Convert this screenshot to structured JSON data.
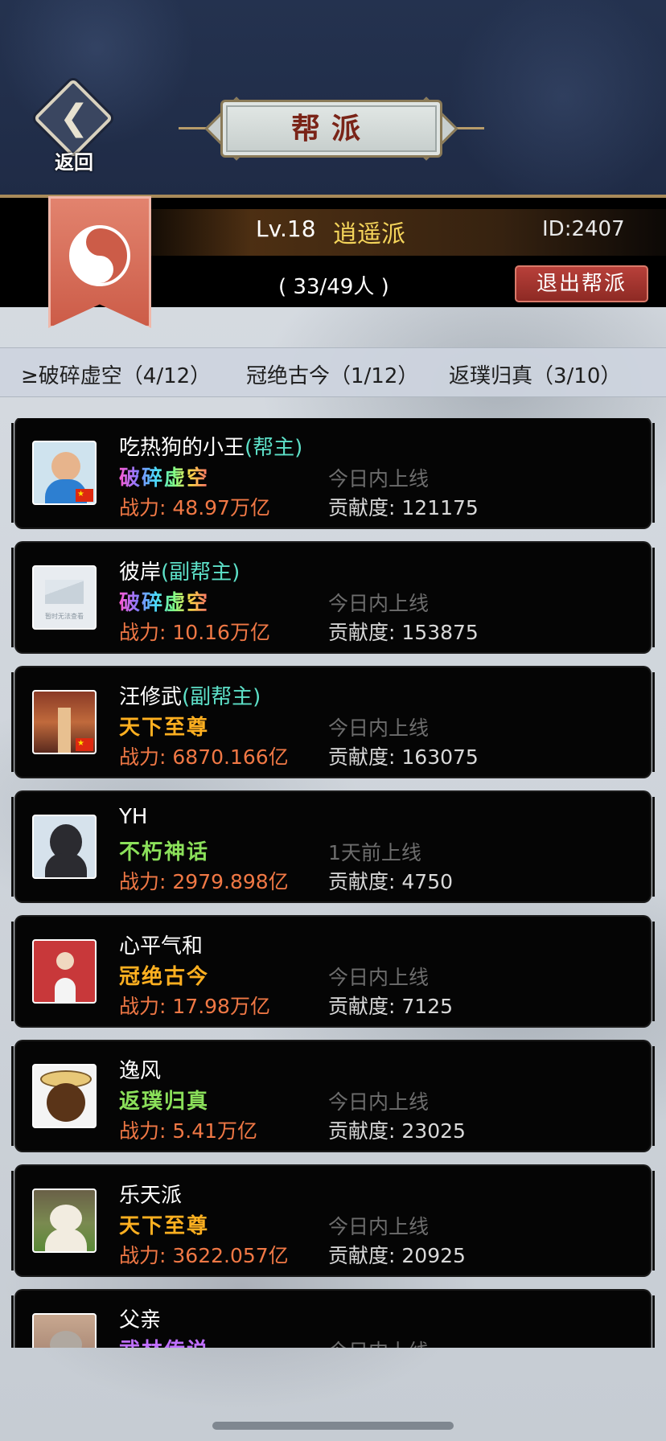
{
  "header": {
    "back_label": "返回",
    "title": "帮派"
  },
  "guild": {
    "level": "Lv.18",
    "name": "逍遥派",
    "id": "ID:2407",
    "members": "( 33/49人 )",
    "quit_label": "退出帮派"
  },
  "realm_summary": [
    "≥破碎虚空（4/12）",
    "冠绝古今（1/12）",
    "返璞归真（3/10）"
  ],
  "members": [
    {
      "name": "吃热狗的小王",
      "role": "(帮主)",
      "realm": "破碎虚空",
      "realm_style": "rainbow",
      "power_label": "战力:",
      "power": "48.97万亿",
      "online": "今日内上线",
      "contrib_label": "贡献度:",
      "contrib": "121175",
      "avatar": "person-with-glasses",
      "flag": true
    },
    {
      "name": "彼岸",
      "role": "(副帮主)",
      "realm": "破碎虚空",
      "realm_style": "rainbow",
      "power_label": "战力:",
      "power": "10.16万亿",
      "online": "今日内上线",
      "contrib_label": "贡献度:",
      "contrib": "153875",
      "avatar": "placeholder-image",
      "avatar_text": "暂时无法查看",
      "flag": false
    },
    {
      "name": "汪修武",
      "role": "(副帮主)",
      "realm": "天下至尊",
      "realm_color": "#ffb020",
      "power_label": "战力:",
      "power": "6870.166亿",
      "online": "今日内上线",
      "contrib_label": "贡献度:",
      "contrib": "163075",
      "avatar": "autumn-forest",
      "flag": true
    },
    {
      "name": "YH",
      "role": "",
      "realm": "不朽神话",
      "realm_color": "#8be05a",
      "power_label": "战力:",
      "power": "2979.898亿",
      "online": "1天前上线",
      "contrib_label": "贡献度:",
      "contrib": "4750",
      "avatar": "hooded-person",
      "flag": false
    },
    {
      "name": "心平气和",
      "role": "",
      "realm": "冠绝古今",
      "realm_color": "#ffb020",
      "power_label": "战力:",
      "power": "17.98万亿",
      "online": "今日内上线",
      "contrib_label": "贡献度:",
      "contrib": "7125",
      "avatar": "person-on-red",
      "flag": false
    },
    {
      "name": "逸风",
      "role": "",
      "realm": "返璞归真",
      "realm_color": "#8be05a",
      "power_label": "战力:",
      "power": "5.41万亿",
      "online": "今日内上线",
      "contrib_label": "贡献度:",
      "contrib": "23025",
      "avatar": "cartoon-face-hat",
      "flag": false
    },
    {
      "name": "乐天派",
      "role": "",
      "realm": "天下至尊",
      "realm_color": "#ffb020",
      "power_label": "战力:",
      "power": "3622.057亿",
      "online": "今日内上线",
      "contrib_label": "贡献度:",
      "contrib": "20925",
      "avatar": "puppy-on-grass",
      "flag": false
    },
    {
      "name": "父亲",
      "role": "",
      "realm": "武林传说",
      "realm_color": "#c070ff",
      "power_label": "",
      "power": "",
      "online": "今日内上线",
      "contrib_label": "",
      "contrib": "",
      "avatar": "cat",
      "flag": false
    }
  ],
  "colors": {
    "header_bg": "#1f2b46",
    "role": "#5de0c8",
    "power": "#f07845",
    "quit_button": "#a83630",
    "guild_name": "#f4d45a"
  }
}
